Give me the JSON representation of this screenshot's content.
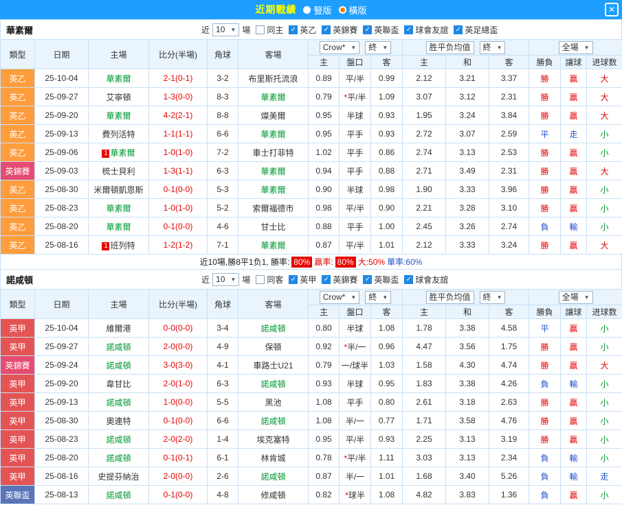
{
  "titlebar": {
    "title": "近期戰績",
    "layout_options": [
      {
        "label": "豎版",
        "selected": false
      },
      {
        "label": "橫版",
        "selected": true
      }
    ],
    "close_icon": "✕"
  },
  "colors": {
    "titlebar_bg": "#1e9fff",
    "title_yellow": "#ffff00",
    "radio_orange": "#ff7a00",
    "header_bg": "#e9f4fd",
    "border": "#c9e0f5",
    "checkbox_blue": "#1e88e5",
    "red": "#e60000",
    "blue": "#2353cc",
    "green": "#009933",
    "focus_team_green": "#009933",
    "score_red": "#e60000",
    "league": {
      "英乙": "#ff9d3d",
      "英甲": "#e45454",
      "英錦賽": "#e64c70",
      "英聯盃": "#5b74b8"
    }
  },
  "table_header": {
    "cols": [
      "類型",
      "日期",
      "主場",
      "比分(半場)",
      "角球",
      "客場"
    ],
    "odds_select": "Crow*",
    "odds_final": "終",
    "odds_sub": [
      "主",
      "盤口",
      "客"
    ],
    "avg_label": "胜平负均值",
    "avg_final": "終",
    "avg_sub": [
      "主",
      "和",
      "客"
    ],
    "scope_select": "全場",
    "result_sub": [
      "勝負",
      "讓球",
      "进球数"
    ]
  },
  "sections": [
    {
      "team": "華素爾",
      "filter": {
        "near_label": "近",
        "count": "10",
        "matches_label": "場",
        "checkboxes": [
          {
            "label": "同主",
            "checked": false
          },
          {
            "label": "英乙",
            "checked": true
          },
          {
            "label": "英錦賽",
            "checked": true
          },
          {
            "label": "英聯盃",
            "checked": true
          },
          {
            "label": "球會友誼",
            "checked": true
          },
          {
            "label": "英足總盃",
            "checked": true
          }
        ]
      },
      "rows": [
        {
          "lg": "英乙",
          "date": "25-10-04",
          "home": "華素爾",
          "hG": true,
          "score": "2-1(0-1)",
          "cor": "3-2",
          "away": "布里斯托流浪",
          "aG": false,
          "o1": "0.89",
          "hc": "平/半",
          "star": false,
          "o2": "0.99",
          "a1": "2.12",
          "a2": "3.21",
          "a3": "3.37",
          "r1": [
            "勝",
            "r"
          ],
          "r2": [
            "贏",
            "r"
          ],
          "r3": [
            "大",
            "r"
          ]
        },
        {
          "lg": "英乙",
          "date": "25-09-27",
          "home": "艾寧頓",
          "hG": false,
          "score": "1-3(0-0)",
          "cor": "8-3",
          "away": "華素爾",
          "aG": true,
          "o1": "0.79",
          "hc": "平/半",
          "star": true,
          "o2": "1.09",
          "a1": "3.07",
          "a2": "3.12",
          "a3": "2.31",
          "r1": [
            "勝",
            "r"
          ],
          "r2": [
            "贏",
            "r"
          ],
          "r3": [
            "大",
            "r"
          ]
        },
        {
          "lg": "英乙",
          "date": "25-09-20",
          "home": "華素爾",
          "hG": true,
          "score": "4-2(2-1)",
          "cor": "8-8",
          "away": "燦美爾",
          "aG": false,
          "o1": "0.95",
          "hc": "半球",
          "star": false,
          "o2": "0.93",
          "a1": "1.95",
          "a2": "3.24",
          "a3": "3.84",
          "r1": [
            "勝",
            "r"
          ],
          "r2": [
            "贏",
            "r"
          ],
          "r3": [
            "大",
            "r"
          ]
        },
        {
          "lg": "英乙",
          "date": "25-09-13",
          "home": "費列活特",
          "hG": false,
          "score": "1-1(1-1)",
          "cor": "6-6",
          "away": "華素爾",
          "aG": true,
          "o1": "0.95",
          "hc": "平手",
          "star": false,
          "o2": "0.93",
          "a1": "2.72",
          "a2": "3.07",
          "a3": "2.59",
          "r1": [
            "平",
            "b"
          ],
          "r2": [
            "走",
            "b"
          ],
          "r3": [
            "小",
            "g"
          ]
        },
        {
          "lg": "英乙",
          "date": "25-09-06",
          "home": "華素爾",
          "hG": true,
          "hB": "1",
          "score": "1-0(1-0)",
          "cor": "7-2",
          "away": "車士打菲特",
          "aG": false,
          "o1": "1.02",
          "hc": "平手",
          "star": false,
          "o2": "0.86",
          "a1": "2.74",
          "a2": "3.13",
          "a3": "2.53",
          "r1": [
            "勝",
            "r"
          ],
          "r2": [
            "贏",
            "r"
          ],
          "r3": [
            "小",
            "g"
          ]
        },
        {
          "lg": "英錦賽",
          "date": "25-09-03",
          "home": "梳士貝利",
          "hG": false,
          "score": "1-3(1-1)",
          "cor": "6-3",
          "away": "華素爾",
          "aG": true,
          "o1": "0.94",
          "hc": "平手",
          "star": false,
          "o2": "0.88",
          "a1": "2.71",
          "a2": "3.49",
          "a3": "2.31",
          "r1": [
            "勝",
            "r"
          ],
          "r2": [
            "贏",
            "r"
          ],
          "r3": [
            "大",
            "r"
          ]
        },
        {
          "lg": "英乙",
          "date": "25-08-30",
          "home": "米爾頓凱恩斯",
          "hG": false,
          "score": "0-1(0-0)",
          "cor": "5-3",
          "away": "華素爾",
          "aG": true,
          "o1": "0.90",
          "hc": "半球",
          "star": false,
          "o2": "0.98",
          "a1": "1.90",
          "a2": "3.33",
          "a3": "3.96",
          "r1": [
            "勝",
            "r"
          ],
          "r2": [
            "贏",
            "r"
          ],
          "r3": [
            "小",
            "g"
          ]
        },
        {
          "lg": "英乙",
          "date": "25-08-23",
          "home": "華素爾",
          "hG": true,
          "score": "1-0(1-0)",
          "cor": "5-2",
          "away": "索爾福德市",
          "aG": false,
          "o1": "0.98",
          "hc": "平/半",
          "star": false,
          "o2": "0.90",
          "a1": "2.21",
          "a2": "3.28",
          "a3": "3.10",
          "r1": [
            "勝",
            "r"
          ],
          "r2": [
            "贏",
            "r"
          ],
          "r3": [
            "小",
            "g"
          ]
        },
        {
          "lg": "英乙",
          "date": "25-08-20",
          "home": "華素爾",
          "hG": true,
          "score": "0-1(0-0)",
          "cor": "4-6",
          "away": "甘士比",
          "aG": false,
          "o1": "0.88",
          "hc": "平手",
          "star": false,
          "o2": "1.00",
          "a1": "2.45",
          "a2": "3.26",
          "a3": "2.74",
          "r1": [
            "負",
            "b"
          ],
          "r2": [
            "輸",
            "b"
          ],
          "r3": [
            "小",
            "g"
          ]
        },
        {
          "lg": "英乙",
          "date": "25-08-16",
          "home": "班列特",
          "hG": false,
          "hB": "1",
          "score": "1-2(1-2)",
          "cor": "7-1",
          "away": "華素爾",
          "aG": true,
          "o1": "0.87",
          "hc": "平/半",
          "star": false,
          "o2": "1.01",
          "a1": "2.12",
          "a2": "3.33",
          "a3": "3.24",
          "r1": [
            "勝",
            "r"
          ],
          "r2": [
            "贏",
            "r"
          ],
          "r3": [
            "大",
            "r"
          ]
        }
      ],
      "summary": {
        "segments": [
          {
            "style": "dark",
            "text": "近10場,勝8平1负1, 勝率:"
          },
          {
            "style": "badge",
            "text": "80%"
          },
          {
            "style": "red",
            "text": "贏率:"
          },
          {
            "style": "badge",
            "text": "80%"
          },
          {
            "style": "red",
            "text": "大:50%"
          },
          {
            "style": "blue",
            "text": "單率:60%"
          }
        ]
      }
    },
    {
      "team": "諾咸頓",
      "filter": {
        "near_label": "近",
        "count": "10",
        "matches_label": "場",
        "checkboxes": [
          {
            "label": "同客",
            "checked": false
          },
          {
            "label": "英甲",
            "checked": true
          },
          {
            "label": "英錦賽",
            "checked": true
          },
          {
            "label": "英聯盃",
            "checked": true
          },
          {
            "label": "球會友誼",
            "checked": true
          }
        ]
      },
      "rows": [
        {
          "lg": "英甲",
          "date": "25-10-04",
          "home": "維爾港",
          "hG": false,
          "score": "0-0(0-0)",
          "cor": "3-4",
          "away": "諾咸頓",
          "aG": true,
          "o1": "0.80",
          "hc": "半球",
          "star": false,
          "o2": "1.08",
          "a1": "1.78",
          "a2": "3.38",
          "a3": "4.58",
          "r1": [
            "平",
            "b"
          ],
          "r2": [
            "贏",
            "r"
          ],
          "r3": [
            "小",
            "g"
          ]
        },
        {
          "lg": "英甲",
          "date": "25-09-27",
          "home": "諾咸頓",
          "hG": true,
          "score": "2-0(0-0)",
          "cor": "4-9",
          "away": "保頓",
          "aG": false,
          "o1": "0.92",
          "hc": "半/一",
          "star": true,
          "o2": "0.96",
          "a1": "4.47",
          "a2": "3.56",
          "a3": "1.75",
          "r1": [
            "勝",
            "r"
          ],
          "r2": [
            "贏",
            "r"
          ],
          "r3": [
            "小",
            "g"
          ]
        },
        {
          "lg": "英錦賽",
          "date": "25-09-24",
          "home": "諾咸頓",
          "hG": true,
          "score": "3-0(3-0)",
          "cor": "4-1",
          "away": "車路士U21",
          "aG": false,
          "o1": "0.79",
          "hc": "一/球半",
          "star": false,
          "o2": "1.03",
          "a1": "1.58",
          "a2": "4.30",
          "a3": "4.74",
          "r1": [
            "勝",
            "r"
          ],
          "r2": [
            "贏",
            "r"
          ],
          "r3": [
            "大",
            "r"
          ]
        },
        {
          "lg": "英甲",
          "date": "25-09-20",
          "home": "韋甘比",
          "hG": false,
          "score": "2-0(1-0)",
          "cor": "6-3",
          "away": "諾咸頓",
          "aG": true,
          "o1": "0.93",
          "hc": "半球",
          "star": false,
          "o2": "0.95",
          "a1": "1.83",
          "a2": "3.38",
          "a3": "4.26",
          "r1": [
            "負",
            "b"
          ],
          "r2": [
            "輸",
            "b"
          ],
          "r3": [
            "小",
            "g"
          ]
        },
        {
          "lg": "英甲",
          "date": "25-09-13",
          "home": "諾咸頓",
          "hG": true,
          "score": "1-0(0-0)",
          "cor": "5-5",
          "away": "黑池",
          "aG": false,
          "o1": "1.08",
          "hc": "平手",
          "star": false,
          "o2": "0.80",
          "a1": "2.61",
          "a2": "3.18",
          "a3": "2.63",
          "r1": [
            "勝",
            "r"
          ],
          "r2": [
            "贏",
            "r"
          ],
          "r3": [
            "小",
            "g"
          ]
        },
        {
          "lg": "英甲",
          "date": "25-08-30",
          "home": "奧連特",
          "hG": false,
          "score": "0-1(0-0)",
          "cor": "6-6",
          "away": "諾咸頓",
          "aG": true,
          "o1": "1.08",
          "hc": "半/一",
          "star": false,
          "o2": "0.77",
          "a1": "1.71",
          "a2": "3.58",
          "a3": "4.76",
          "r1": [
            "勝",
            "r"
          ],
          "r2": [
            "贏",
            "r"
          ],
          "r3": [
            "小",
            "g"
          ]
        },
        {
          "lg": "英甲",
          "date": "25-08-23",
          "home": "諾咸頓",
          "hG": true,
          "score": "2-0(2-0)",
          "cor": "1-4",
          "away": "埃克塞特",
          "aG": false,
          "o1": "0.95",
          "hc": "平/半",
          "star": false,
          "o2": "0.93",
          "a1": "2.25",
          "a2": "3.13",
          "a3": "3.19",
          "r1": [
            "勝",
            "r"
          ],
          "r2": [
            "贏",
            "r"
          ],
          "r3": [
            "小",
            "g"
          ]
        },
        {
          "lg": "英甲",
          "date": "25-08-20",
          "home": "諾咸頓",
          "hG": true,
          "score": "0-1(0-1)",
          "cor": "6-1",
          "away": "林肯城",
          "aG": false,
          "o1": "0.78",
          "hc": "平/半",
          "star": true,
          "o2": "1.11",
          "a1": "3.03",
          "a2": "3.13",
          "a3": "2.34",
          "r1": [
            "負",
            "b"
          ],
          "r2": [
            "輸",
            "b"
          ],
          "r3": [
            "小",
            "g"
          ]
        },
        {
          "lg": "英甲",
          "date": "25-08-16",
          "home": "史提芬納治",
          "hG": false,
          "score": "2-0(0-0)",
          "cor": "2-6",
          "away": "諾咸頓",
          "aG": true,
          "o1": "0.87",
          "hc": "半/一",
          "star": false,
          "o2": "1.01",
          "a1": "1.68",
          "a2": "3.40",
          "a3": "5.26",
          "r1": [
            "負",
            "b"
          ],
          "r2": [
            "輸",
            "b"
          ],
          "r3": [
            "走",
            "b"
          ]
        },
        {
          "lg": "英聯盃",
          "date": "25-08-13",
          "home": "諾咸頓",
          "hG": true,
          "score": "0-1(0-0)",
          "cor": "4-8",
          "away": "修咸頓",
          "aG": false,
          "o1": "0.82",
          "hc": "球半",
          "star": true,
          "o2": "1.08",
          "a1": "4.82",
          "a2": "3.83",
          "a3": "1.36",
          "r1": [
            "負",
            "b"
          ],
          "r2": [
            "贏",
            "r"
          ],
          "r3": [
            "小",
            "g"
          ]
        }
      ]
    }
  ]
}
